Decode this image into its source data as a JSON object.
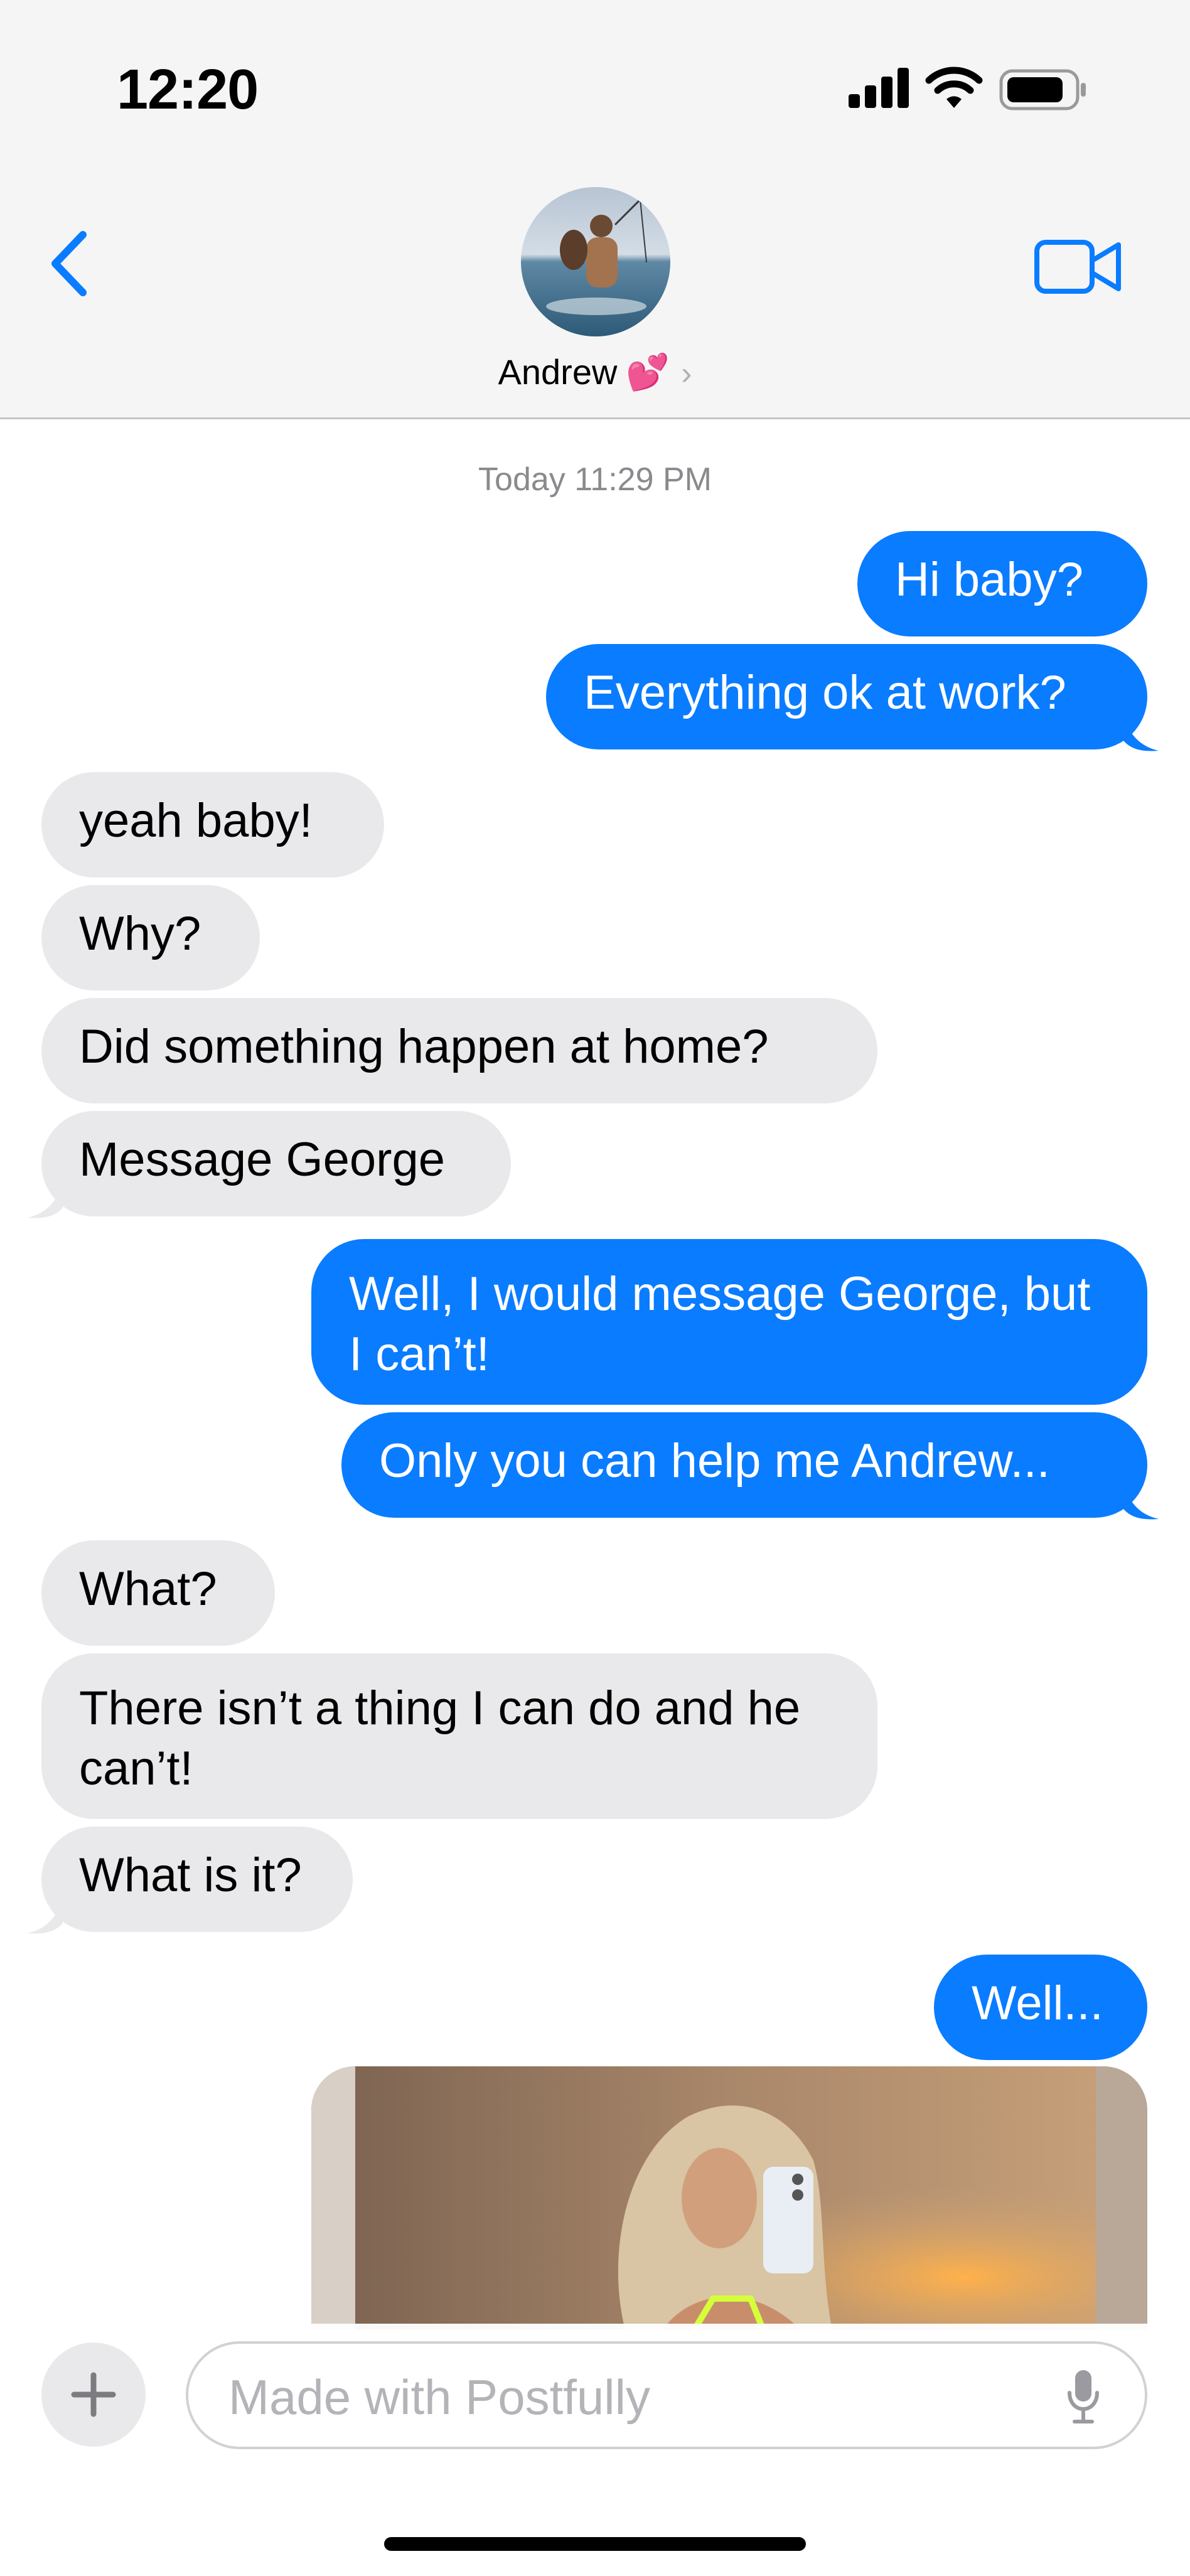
{
  "status_bar": {
    "time": "12:20"
  },
  "header": {
    "contact_name": "Andrew",
    "contact_emoji": "💕",
    "chevron": "›",
    "icons": {
      "back": "chevron-left-icon",
      "video": "video-camera-icon"
    },
    "accent_color": "#0a7cff"
  },
  "conversation": {
    "timestamp": "Today 11:29 PM",
    "messages": [
      {
        "from": "me",
        "text": "Hi baby?"
      },
      {
        "from": "me",
        "text": "Everything ok at work?"
      },
      {
        "from": "them",
        "text": "yeah baby!"
      },
      {
        "from": "them",
        "text": "Why?"
      },
      {
        "from": "them",
        "text": "Did something happen at home?"
      },
      {
        "from": "them",
        "text": "Message George"
      },
      {
        "from": "me",
        "text": "Well, I would message George, but I can’t!"
      },
      {
        "from": "me",
        "text": "Only you can help me Andrew..."
      },
      {
        "from": "them",
        "text": "What?"
      },
      {
        "from": "them",
        "text": "There isn’t a thing I can do and he can’t!"
      },
      {
        "from": "them",
        "text": "What is it?"
      },
      {
        "from": "me",
        "text": "Well..."
      }
    ],
    "attachment": {
      "type": "photo"
    }
  },
  "composer": {
    "placeholder": "Made with Postfully",
    "plus_label": "+",
    "icons": {
      "add": "plus-icon",
      "mic": "microphone-icon"
    }
  },
  "colors": {
    "sent": "#0a7cff",
    "received": "#e9e9eb",
    "timestamp": "#8a8a8e"
  }
}
